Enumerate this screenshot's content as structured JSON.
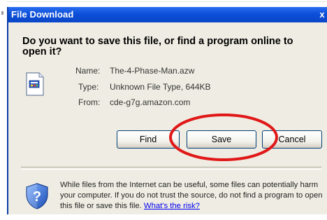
{
  "dialog": {
    "title": "File Download",
    "close_glyph": "x",
    "question": "Do you want to save this file, or find a program online to open it?"
  },
  "file": {
    "icon": "file-icon",
    "name_label": "Name:",
    "name_value": "The-4-Phase-Man.azw",
    "type_label": "Type:",
    "type_value": "Unknown File Type, 644KB",
    "from_label": "From:",
    "from_value": "cde-g7g.amazon.com"
  },
  "buttons": {
    "find": "Find",
    "save": "Save",
    "cancel": "Cancel"
  },
  "warning": {
    "icon": "shield-question-icon",
    "text": "While files from the Internet can be useful, some files can potentially harm your computer. If you do not trust the source, do not find a program to open this file or save this file.",
    "link": "What's the risk?"
  },
  "colors": {
    "titlebar": "#0a46c8",
    "highlight": "#e01818",
    "dialog_bg": "#efede3",
    "link": "#0000ee"
  }
}
